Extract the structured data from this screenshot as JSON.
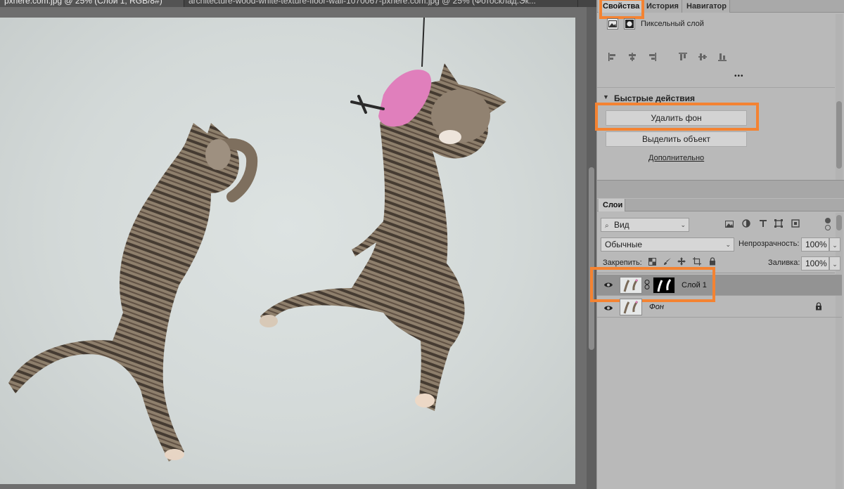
{
  "document_tabs": [
    {
      "label": "pxhere.com.jpg @ 25% (Слой 1, RGB/8#)"
    },
    {
      "label": "architecture-wood-white-texture-floor-wall-1070067-pxhere.com.jpg @ 25% (Фотосклад.Эк..."
    }
  ],
  "properties_panel": {
    "tabs": [
      {
        "label": "Свойства"
      },
      {
        "label": "История"
      },
      {
        "label": "Навигатор"
      }
    ],
    "layer_kind": "Пиксельный слой",
    "more_glyph": "•••",
    "quick_actions": {
      "title": "Быстрые действия",
      "remove_bg": "Удалить фон",
      "select_subject": "Выделить объект",
      "more_link": "Дополнительно"
    }
  },
  "layers_panel": {
    "tab": "Слои",
    "filter": "Вид",
    "blend_mode": "Обычные",
    "opacity_label": "Непрозрачность:",
    "opacity_value": "100%",
    "lock_label": "Закрепить:",
    "fill_label": "Заливка:",
    "fill_value": "100%",
    "layers": [
      {
        "name": "Слой 1",
        "selected": true,
        "has_mask": true
      },
      {
        "name": "Фон",
        "selected": false,
        "locked": true
      }
    ]
  },
  "colors": {
    "highlight": "#f48332",
    "selected_layer": "#939393",
    "panel_bg": "#b9b9b9"
  }
}
